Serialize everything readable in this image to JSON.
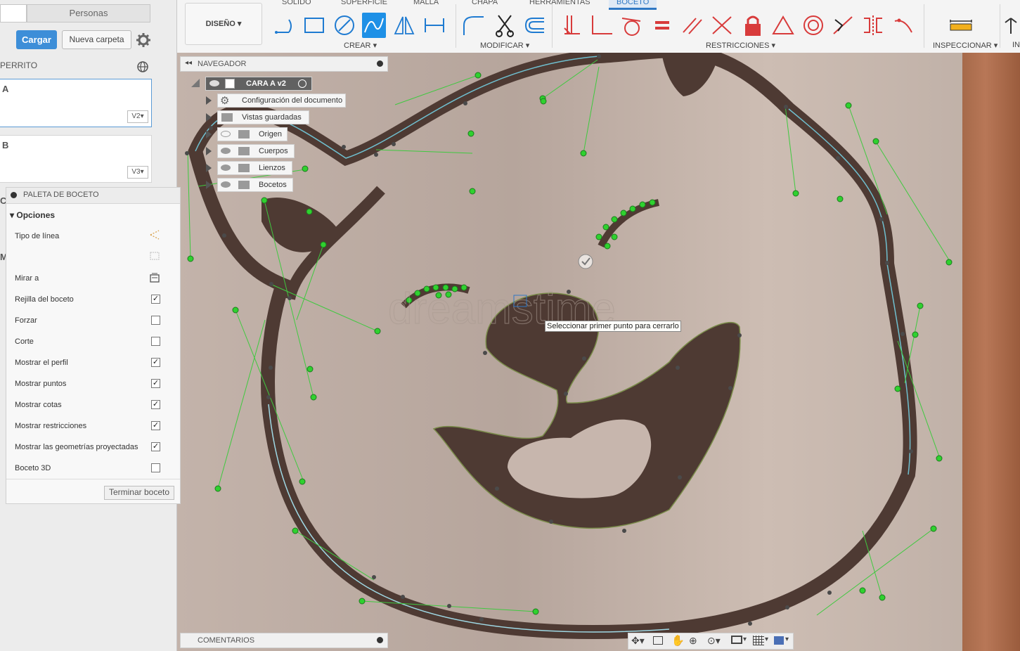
{
  "left_panel": {
    "tab_people": "Personas",
    "load_button": "Cargar",
    "new_folder_button": "Nueva carpeta",
    "project_name": "PERRITO",
    "files": [
      {
        "name": "A",
        "version": "V2"
      },
      {
        "name": "B",
        "version": "V3"
      }
    ],
    "cut_letters": [
      "C",
      "M"
    ]
  },
  "toolbar": {
    "workspace": "DISEÑO",
    "tabs": [
      "SÓLIDO",
      "SUPERFICIE",
      "MALLA",
      "CHAPA",
      "HERRAMIENTAS",
      "BOCETO"
    ],
    "active_tab": "BOCETO",
    "groups": {
      "create": "CREAR",
      "modify": "MODIFICAR",
      "constraints": "RESTRICCIONES",
      "inspect": "INSPECCIONAR",
      "insert": "IN"
    }
  },
  "browser": {
    "title": "NAVEGADOR",
    "root": "CARA A v2",
    "items": [
      "Configuración del documento",
      "Vistas guardadas",
      "Origen",
      "Cuerpos",
      "Lienzos",
      "Bocetos"
    ]
  },
  "sketch_palette": {
    "title": "PALETA DE BOCETO",
    "section": "Opciones",
    "rows": [
      {
        "label": "Tipo de línea",
        "checked": null
      },
      {
        "label": "",
        "checked": null
      },
      {
        "label": "Mirar a",
        "checked": null
      },
      {
        "label": "Rejilla del boceto",
        "checked": true
      },
      {
        "label": "Forzar",
        "checked": false
      },
      {
        "label": "Corte",
        "checked": false
      },
      {
        "label": "Mostrar el perfil",
        "checked": true
      },
      {
        "label": "Mostrar puntos",
        "checked": true
      },
      {
        "label": "Mostrar cotas",
        "checked": true
      },
      {
        "label": "Mostrar restricciones",
        "checked": true
      },
      {
        "label": "Mostrar las geometrías proyectadas",
        "checked": true
      },
      {
        "label": "Boceto 3D",
        "checked": false
      }
    ],
    "finish_button": "Terminar boceto"
  },
  "tooltip": "Seleccionar primer punto para cerrarlo",
  "comments_title": "COMENTARIOS",
  "colors": {
    "accent": "#1e90e6",
    "constraint_red": "#d83b3b",
    "spline_green": "#2fd12f",
    "stroke_brown": "#4e3a33"
  }
}
